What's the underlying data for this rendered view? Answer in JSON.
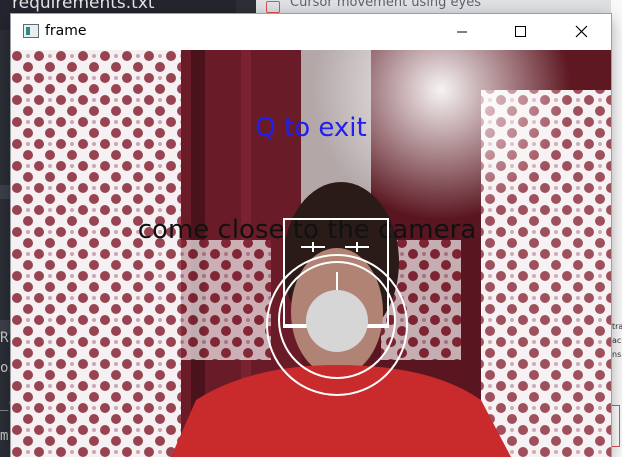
{
  "background": {
    "editor_file": "requirements.txt",
    "editor_fragments": [
      "R",
      "os",
      "_c",
      "m"
    ],
    "browser_tab_title": "Cursor movement using eyes",
    "browser_fragments": [
      "tra",
      "ack",
      "nsi"
    ]
  },
  "window": {
    "title": "frame",
    "controls": {
      "minimize": "minimize-icon",
      "maximize": "maximize-icon",
      "close": "close-icon"
    }
  },
  "overlay": {
    "exit_text": "Q to exit",
    "prompt_text": "come close to the camera",
    "exit_color": "#1f1ff0",
    "prompt_color": "#111111",
    "shape_color": "#ffffff",
    "fill_color": "#d6d6d6"
  }
}
